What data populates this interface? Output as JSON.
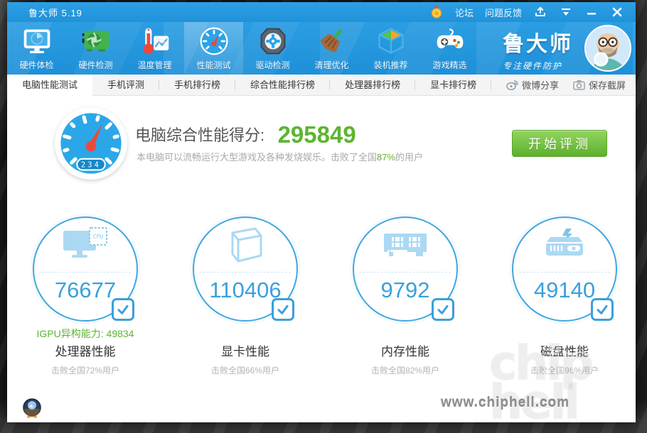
{
  "titlebar": {
    "title": "鲁大师 5.19",
    "forum": "论坛",
    "feedback": "问题反馈"
  },
  "toolbar": {
    "items": [
      {
        "label": "硬件体检"
      },
      {
        "label": "硬件检测"
      },
      {
        "label": "温度管理"
      },
      {
        "label": "性能测试"
      },
      {
        "label": "驱动检测"
      },
      {
        "label": "清理优化"
      },
      {
        "label": "装机推荐"
      },
      {
        "label": "游戏精选"
      }
    ],
    "active_item": "性能测试",
    "brand": {
      "name": "鲁大师",
      "tagline": "专注硬件防护"
    }
  },
  "tabs": {
    "items": [
      "电脑性能测试",
      "手机评测",
      "手机排行榜",
      "综合性能排行榜",
      "处理器排行榜",
      "显卡排行榜"
    ],
    "active": "电脑性能测试",
    "share": "微博分享",
    "screenshot": "保存截屏"
  },
  "score": {
    "gauge_badge": "234",
    "label": "电脑综合性能得分:",
    "value": "295849",
    "desc_prefix": "本电脑可以流畅运行大型游戏及各种发烧娱乐。击败了全国",
    "desc_percent": "87%",
    "desc_suffix": "的用户",
    "start_button": "开始评测"
  },
  "metrics": [
    {
      "name": "处理器性能",
      "score": "76677",
      "beat": "击败全国72%用户",
      "extra_label": "IGPU异构能力:",
      "extra_value": "49834"
    },
    {
      "name": "显卡性能",
      "score": "110406",
      "beat": "击败全国66%用户"
    },
    {
      "name": "内存性能",
      "score": "9792",
      "beat": "击败全国82%用户"
    },
    {
      "name": "磁盘性能",
      "score": "49140",
      "beat": "击败全国96%用户"
    }
  ],
  "icons": {
    "cpu_chip_label": "CPU"
  },
  "watermark": {
    "site": "www.chiphell.com",
    "logo_line1": "chip",
    "logo_line2": "hell"
  },
  "colors": {
    "titlebar_blue": "#2193dc",
    "accent_blue": "#3aa0dc",
    "score_green": "#5cb531",
    "button_green": "#5cb12d"
  }
}
